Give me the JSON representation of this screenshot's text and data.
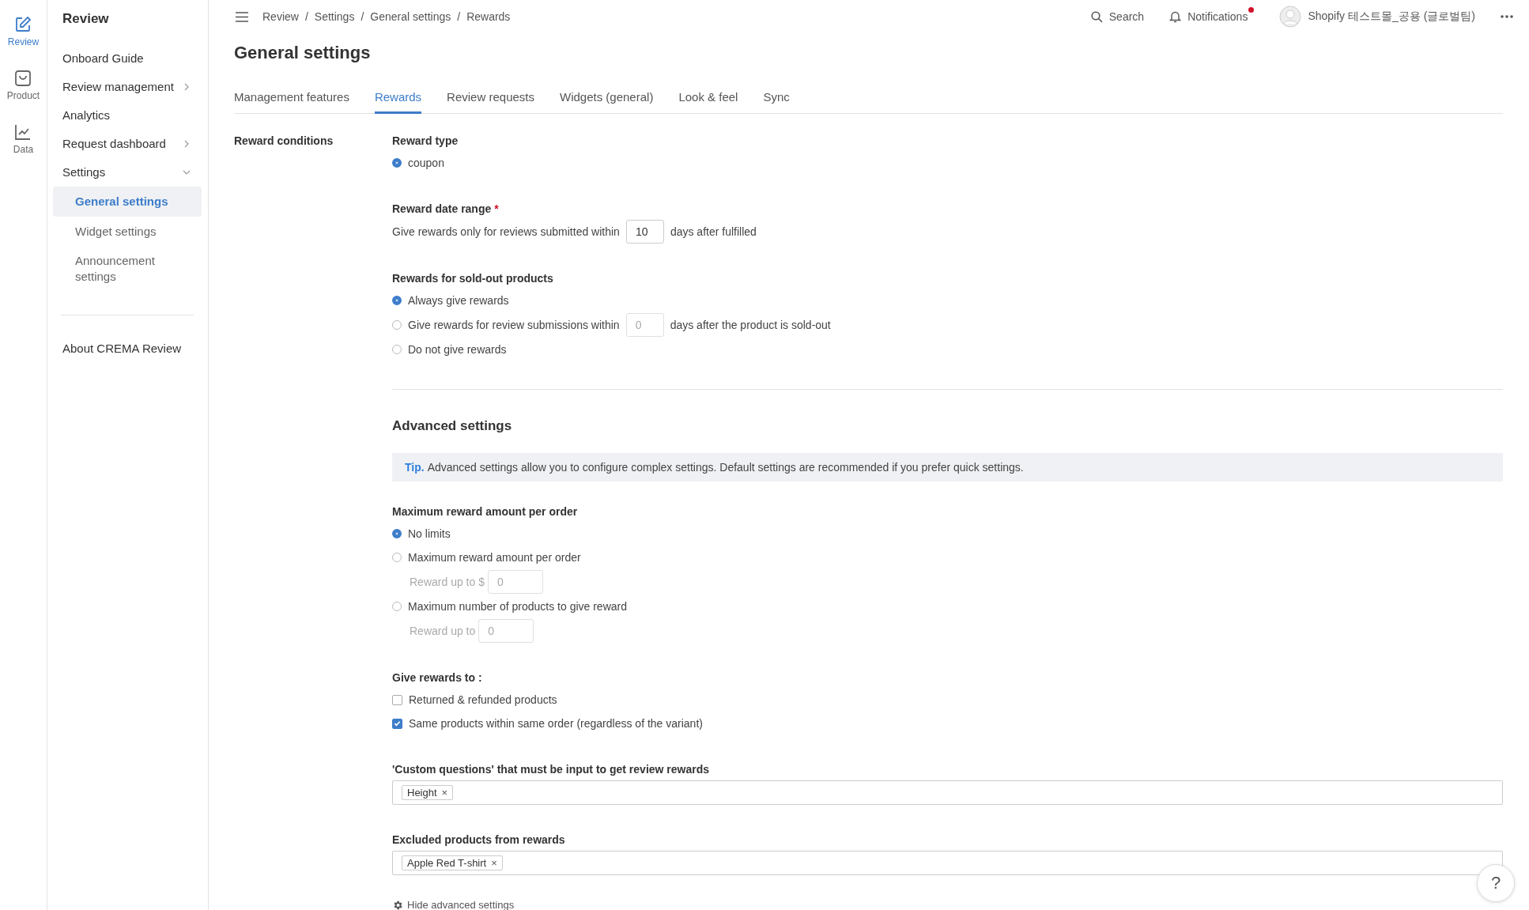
{
  "rail": [
    {
      "label": "Review",
      "selected": true
    },
    {
      "label": "Product",
      "selected": false
    },
    {
      "label": "Data",
      "selected": false
    }
  ],
  "sidebar": {
    "title": "Review",
    "items": [
      {
        "label": "Onboard Guide",
        "selected": false
      },
      {
        "label": "Review management",
        "expanded": false,
        "selected": false
      },
      {
        "label": "Analytics",
        "selected": false
      },
      {
        "label": "Request dashboard",
        "expanded": false,
        "selected": false
      },
      {
        "label": "Settings",
        "expanded": true,
        "selected": false,
        "children": [
          {
            "label": "General settings",
            "selected": true
          },
          {
            "label": "Widget settings",
            "selected": false
          },
          {
            "label": "Announcement settings",
            "selected": false
          }
        ]
      }
    ],
    "footer_items": [
      {
        "label": "About CREMA Review",
        "selected": false
      }
    ]
  },
  "topbar": {
    "breadcrumbs": [
      "Review",
      "Settings",
      "General settings",
      "Rewards"
    ],
    "separator": "/",
    "search": "Search",
    "notifications": {
      "label": "Notifications",
      "unread": true
    },
    "account": "Shopify 테스트몰_공용 (글로벌팀)"
  },
  "page_title": "General settings",
  "tabs": [
    {
      "label": "Management features",
      "selected": false
    },
    {
      "label": "Rewards",
      "selected": true
    },
    {
      "label": "Review requests",
      "selected": false
    },
    {
      "label": "Widgets (general)",
      "selected": false
    },
    {
      "label": "Look & feel",
      "selected": false
    },
    {
      "label": "Sync",
      "selected": false
    }
  ],
  "reward_conditions": {
    "label": "Reward conditions",
    "reward_type": {
      "label": "Reward type",
      "options": [
        {
          "label": "coupon",
          "selected": true
        }
      ]
    },
    "date_range": {
      "label": "Reward date range",
      "required_mark": "*",
      "before": "Give rewards only for reviews submitted within",
      "value": "10",
      "after": "days after fulfilled"
    },
    "sold_out": {
      "label": "Rewards for sold-out products",
      "options": [
        {
          "kind": "plain",
          "label": "Always give rewards",
          "selected": true
        },
        {
          "kind": "days",
          "label": "Give rewards for review submissions within",
          "placeholder": "0",
          "after": "days after the product is sold-out",
          "selected": false
        },
        {
          "kind": "plain",
          "label": "Do not give rewards",
          "selected": false
        }
      ]
    }
  },
  "advanced": {
    "title": "Advanced settings",
    "tip": {
      "label": "Tip.",
      "text": "Advanced settings allow you to configure complex settings. Default settings are recommended if you prefer quick settings."
    },
    "max_reward": {
      "label": "Maximum reward amount per order",
      "options": [
        {
          "label": "No limits",
          "selected": true
        },
        {
          "label": "Maximum reward amount per order",
          "selected": false,
          "sub": {
            "label": "Reward up to $",
            "placeholder": "0"
          }
        },
        {
          "label": "Maximum number of products to give reward",
          "selected": false,
          "sub": {
            "label": "Reward up to",
            "placeholder": "0"
          }
        }
      ]
    },
    "give_rewards_to": {
      "label": "Give rewards to :",
      "options": [
        {
          "label": "Returned & refunded products",
          "checked": false
        },
        {
          "label": "Same products within same order (regardless of the variant)",
          "checked": true
        }
      ]
    },
    "custom_questions": {
      "label": "'Custom questions' that must be input to get review rewards",
      "tags": [
        {
          "label": "Height",
          "remove": "×"
        }
      ]
    },
    "excluded_products": {
      "label": "Excluded products from rewards",
      "tags": [
        {
          "label": "Apple Red T-shirt",
          "remove": "×"
        }
      ]
    },
    "hide_link": "Hide advanced settings"
  },
  "help": "?"
}
